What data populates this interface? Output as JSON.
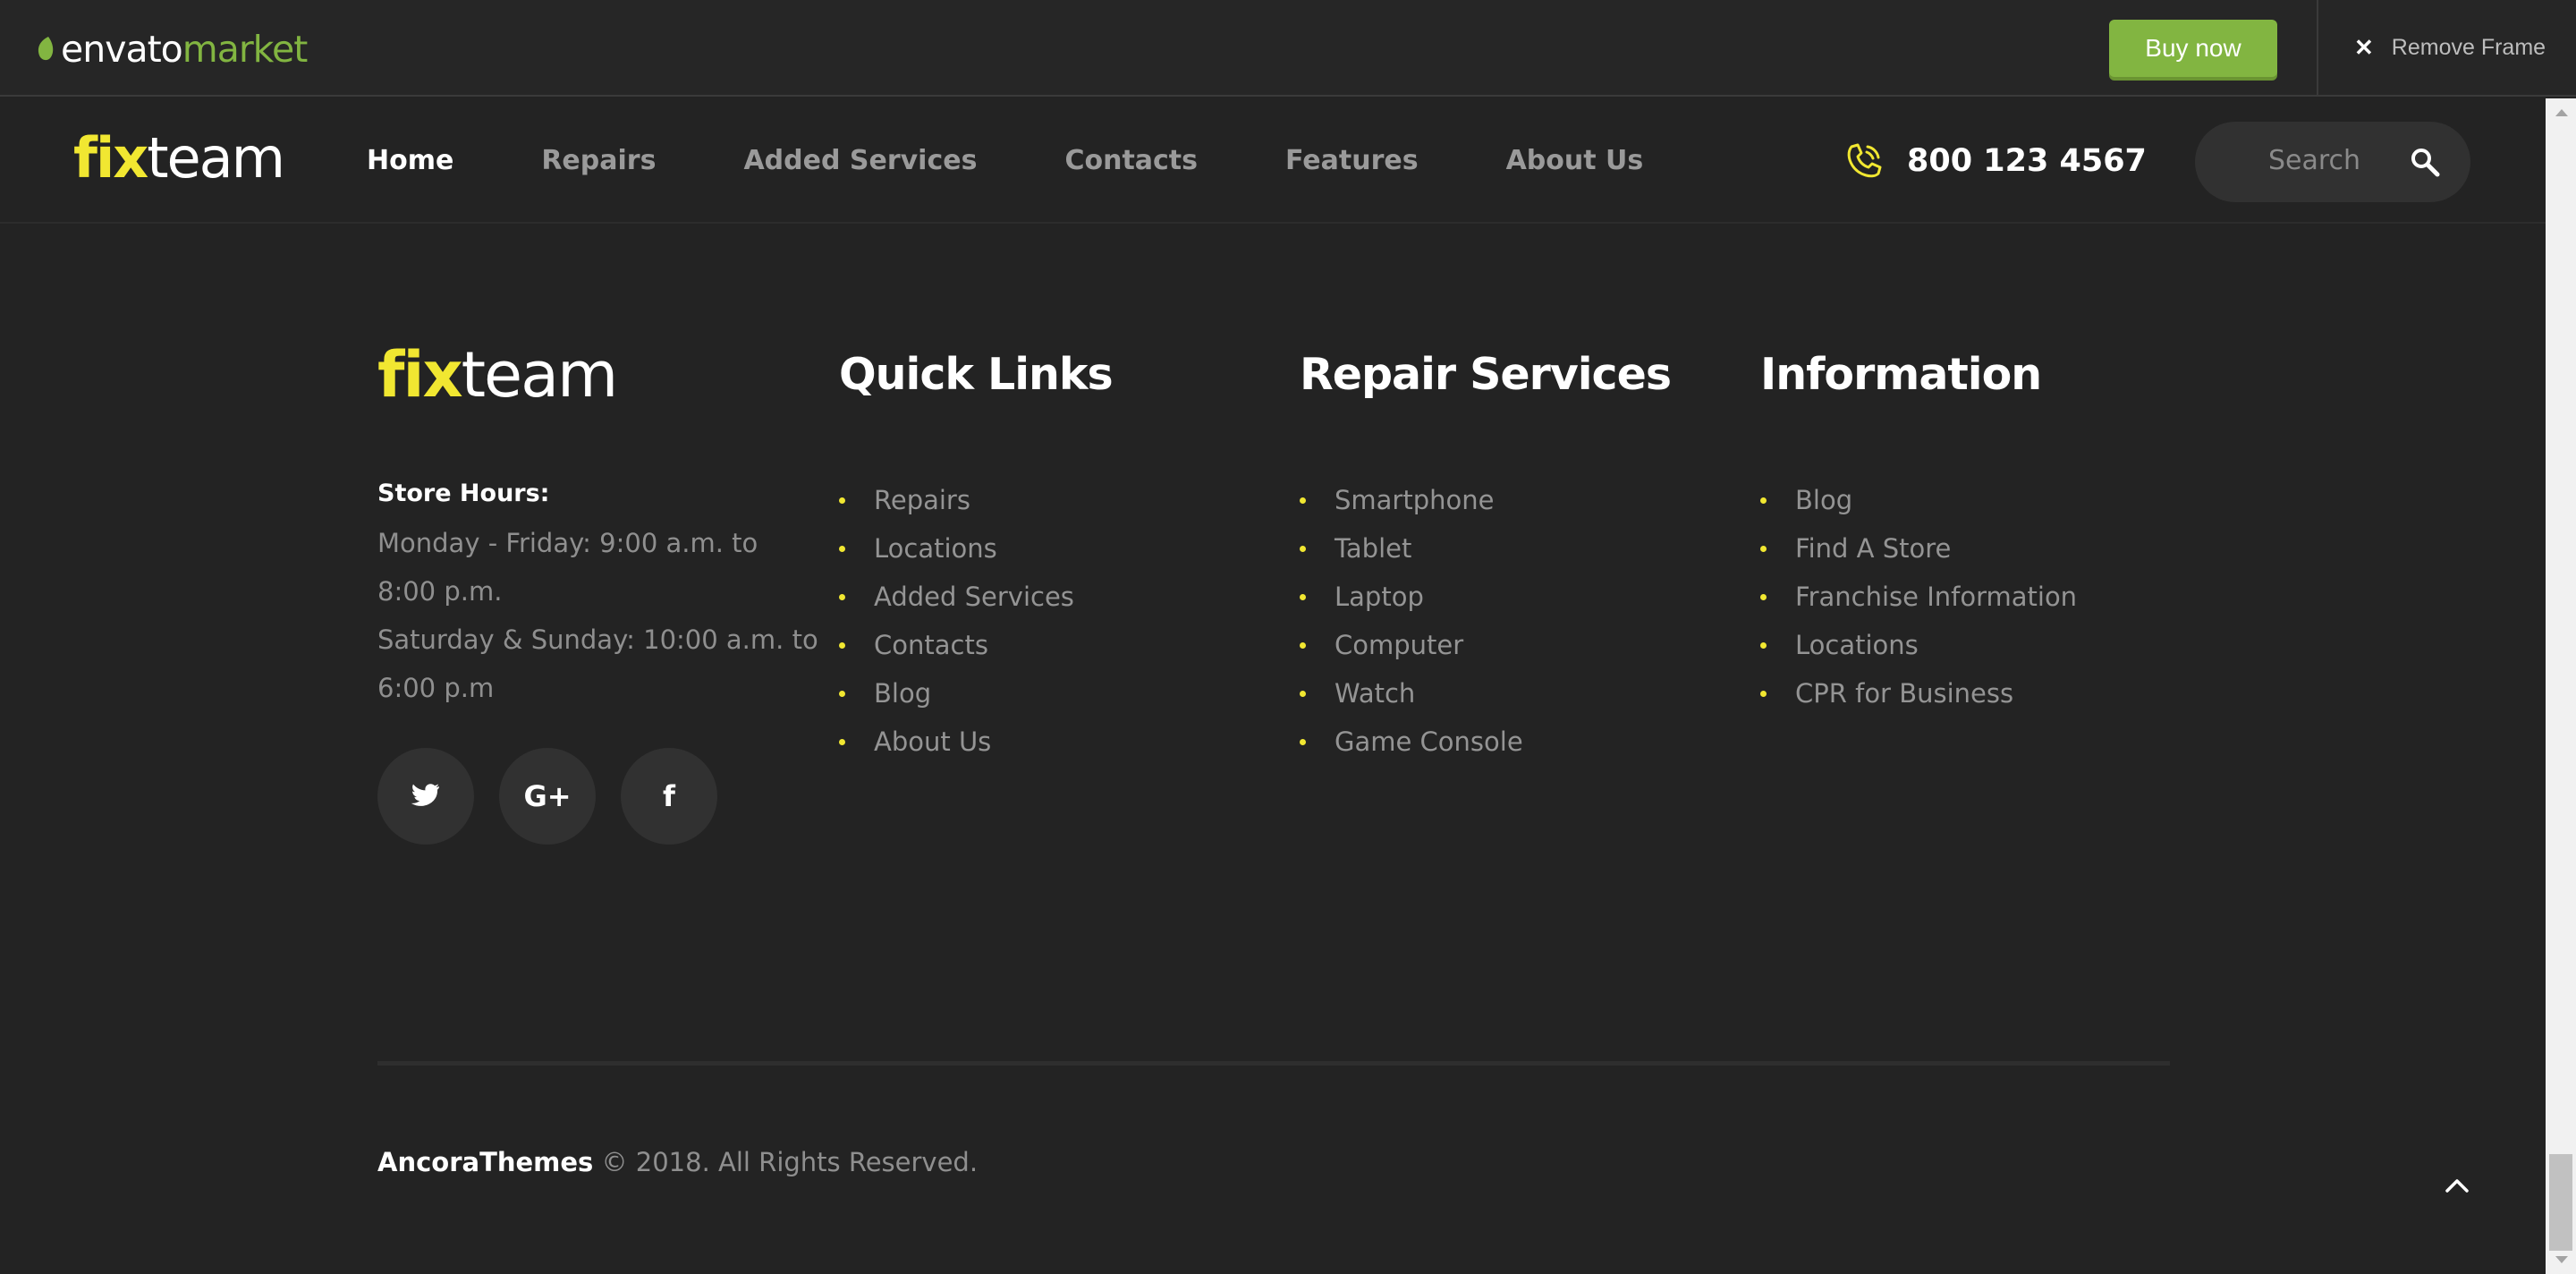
{
  "envato": {
    "logo_word": "envato",
    "logo_market": "market",
    "buy_label": "Buy now",
    "remove_label": "Remove Frame",
    "accent": "#82b541"
  },
  "header": {
    "logo_fix": "fix",
    "logo_team": "team",
    "nav": [
      "Home",
      "Repairs",
      "Added Services",
      "Contacts",
      "Features",
      "About Us"
    ],
    "active_nav": "Home",
    "phone": "800 123 4567",
    "search_placeholder": "Search",
    "accent": "#f1e731"
  },
  "footer": {
    "logo_fix": "fix",
    "logo_team": "team",
    "store_hours_label": "Store Hours:",
    "hours_lines": [
      "Monday - Friday: 9:00 a.m. to",
      "8:00 p.m.",
      "Saturday & Sunday: 10:00 a.m. to",
      "6:00 p.m"
    ],
    "social": [
      "twitter-icon",
      "google-plus-icon",
      "facebook-icon"
    ],
    "columns": [
      {
        "title": "Quick Links",
        "items": [
          "Repairs",
          "Locations",
          "Added Services",
          "Contacts",
          "Blog",
          "About Us"
        ]
      },
      {
        "title": "Repair Services",
        "items": [
          "Smartphone",
          "Tablet",
          "Laptop",
          "Computer",
          "Watch",
          "Game Console"
        ]
      },
      {
        "title": "Information",
        "items": [
          "Blog",
          "Find A Store",
          "Franchise Information",
          "Locations",
          "CPR for Business"
        ]
      }
    ],
    "copyright_brand": "AncoraThemes",
    "copyright_text": "© 2018. All Rights Reserved."
  }
}
